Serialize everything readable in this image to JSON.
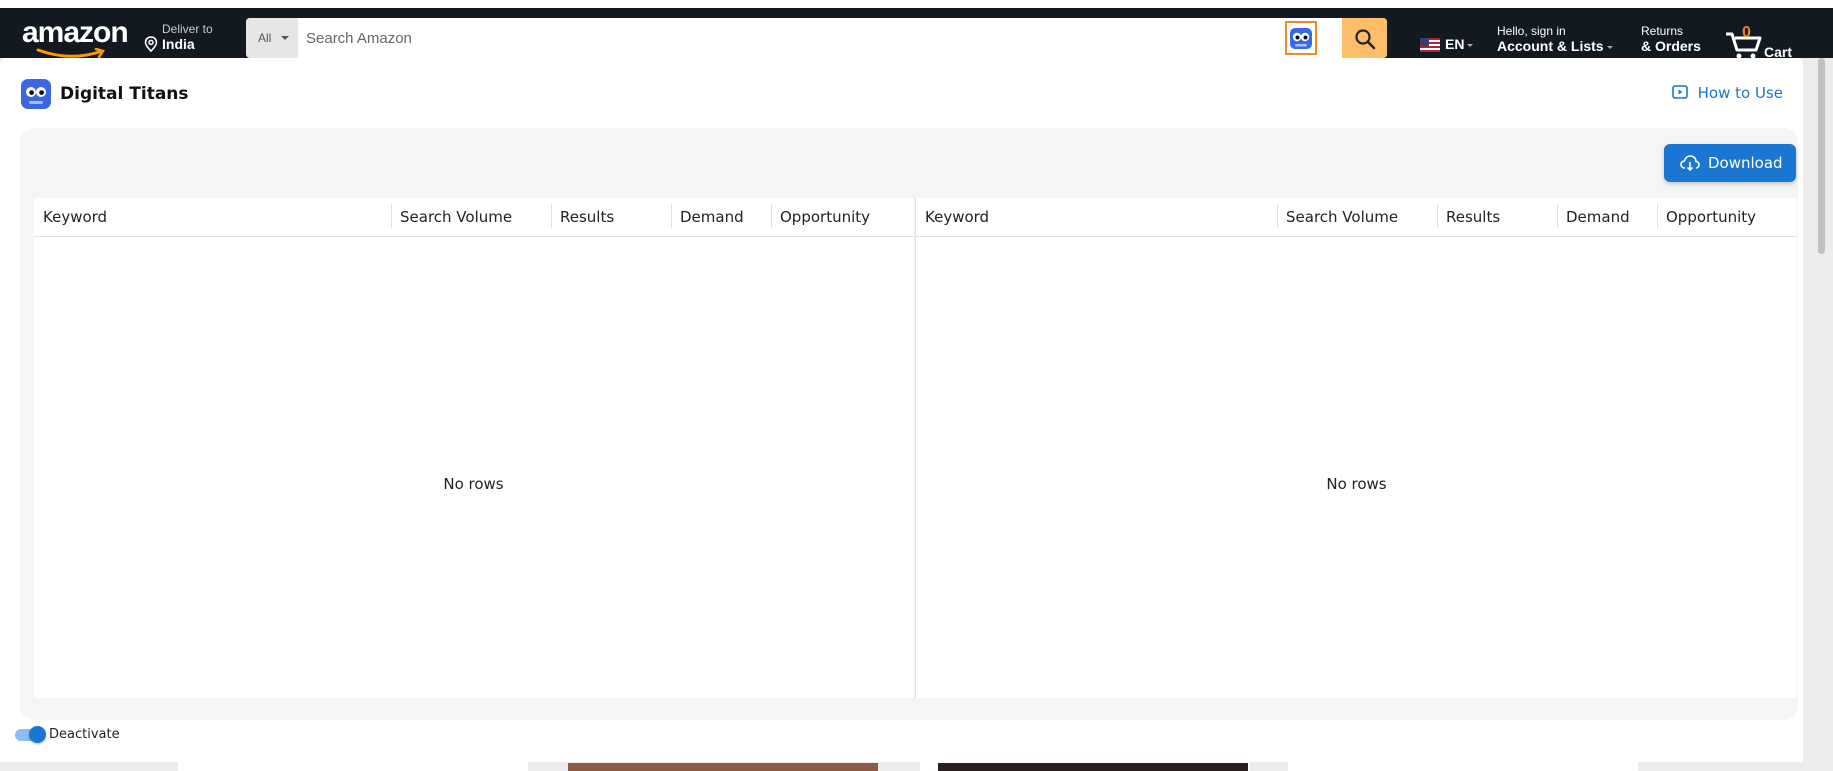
{
  "amazon": {
    "logo_text": "amazon",
    "deliver_line1": "Deliver to",
    "deliver_line2": "India",
    "search_category": "All",
    "search_placeholder": "Search Amazon",
    "language": "EN",
    "account_line1": "Hello, sign in",
    "account_line2": "Account & Lists",
    "returns_line1": "Returns",
    "returns_line2": "& Orders",
    "cart_count": "0",
    "cart_label": "Cart",
    "accent_color": "#febd69",
    "header_color": "#131921"
  },
  "extension": {
    "brand_name": "Digital Titans",
    "how_to_use": "How to Use",
    "download_label": "Download",
    "left_table": {
      "columns": [
        "Keyword",
        "Search Volume",
        "Results",
        "Demand",
        "Opportunity"
      ],
      "empty_text": "No rows"
    },
    "right_table": {
      "columns": [
        "Keyword",
        "Search Volume",
        "Results",
        "Demand",
        "Opportunity"
      ],
      "empty_text": "No rows"
    },
    "toggle_label": "Deactivate",
    "toggle_on": true,
    "primary_color": "#1976d2"
  }
}
